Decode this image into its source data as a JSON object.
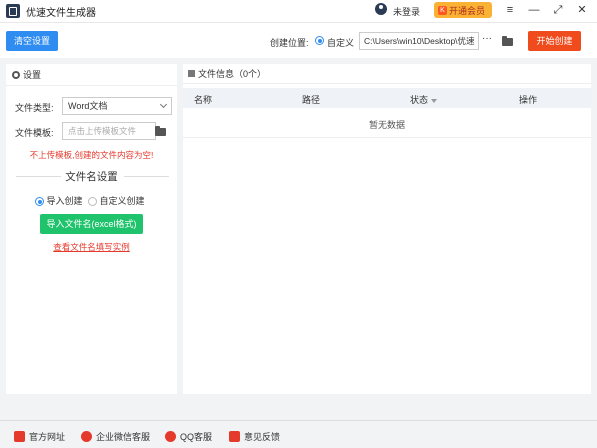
{
  "window": {
    "title": "优速文件生成器",
    "login_text": "未登录",
    "vip_label": "开通会员",
    "vip_icon_glyph": "K",
    "controls": [
      "≡",
      "—",
      "⤢",
      "✕"
    ]
  },
  "toolbar": {
    "clear_label": "清空设置",
    "location_label": "创建位置:",
    "location_option": "自定义",
    "path_value": "C:\\Users\\win10\\Desktop\\优速",
    "more_label": "···",
    "start_label": "开始创建"
  },
  "settings": {
    "header": "设置",
    "file_type_label": "文件类型:",
    "file_type_value": "Word文档",
    "template_label": "文件模板:",
    "template_placeholder": "点击上传模板文件",
    "warning": "不上传模板,创建的文件内容为空!",
    "name_section_title": "文件名设置",
    "option_import": "导入创建",
    "option_custom": "自定义创建",
    "import_button": "导入文件名(excel格式)",
    "example_link": "查看文件名填写实例"
  },
  "file_info": {
    "header": "文件信息（0个）",
    "columns": [
      "名称",
      "路径",
      "状态",
      "操作"
    ],
    "empty_text": "暂无数据"
  },
  "footer": {
    "items": [
      "官方网址",
      "企业微信客服",
      "QQ客服",
      "意见反馈"
    ]
  },
  "colors": {
    "primary": "#2f8cf0",
    "danger": "#f04b1c",
    "success": "#1ec36b",
    "vip": "#f9b233"
  }
}
